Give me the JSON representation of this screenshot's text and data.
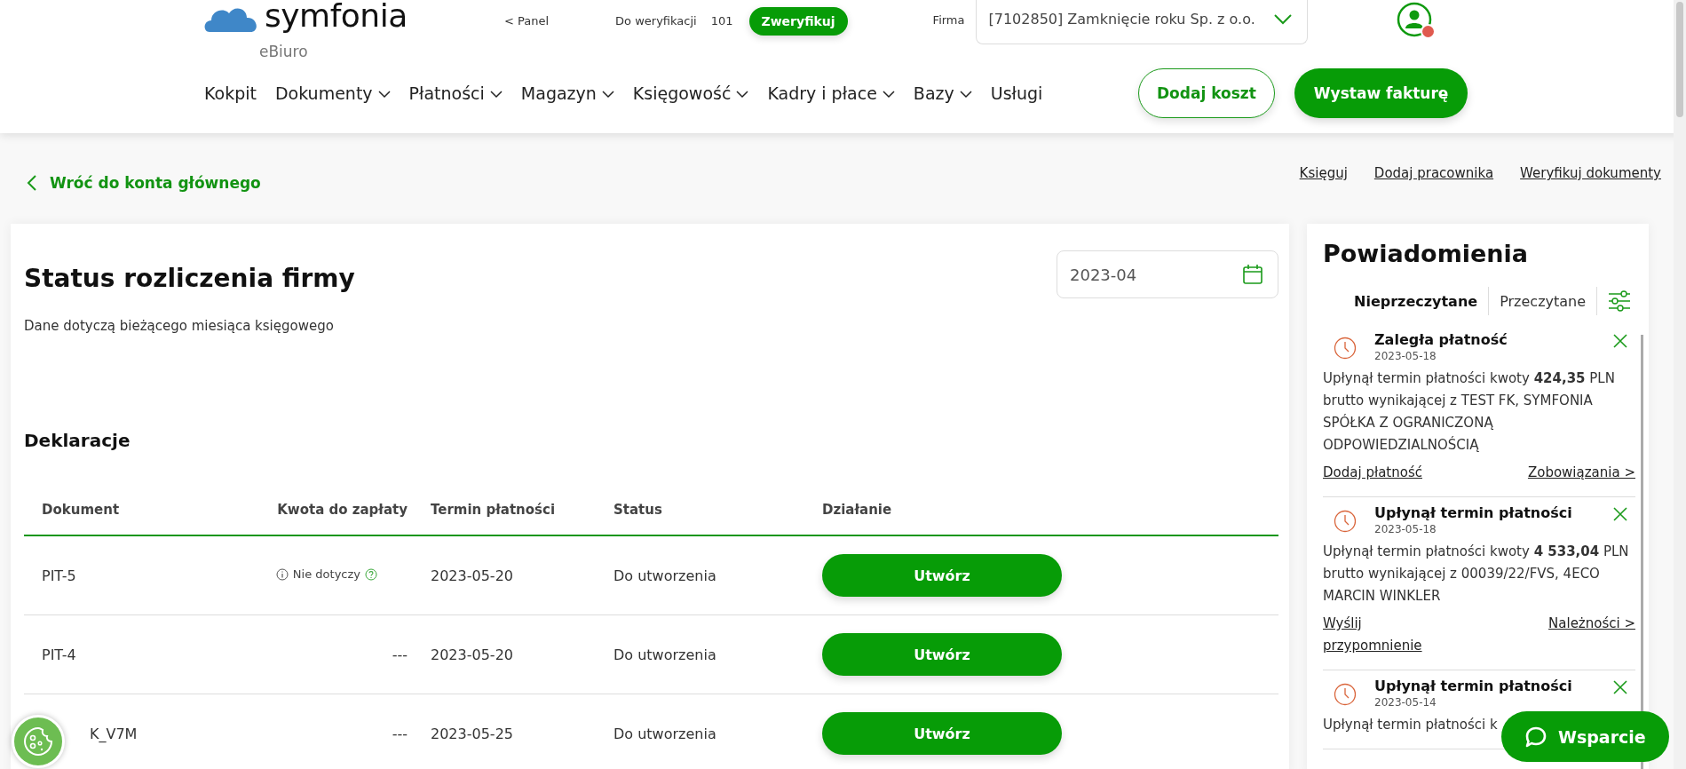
{
  "header": {
    "logo": {
      "name": "symfonia",
      "product": "eBiuro"
    },
    "panel_link": "< Panel",
    "verification": {
      "label": "Do weryfikacji",
      "count": "101",
      "button": "Zweryfikuj"
    },
    "company": {
      "label": "Firma",
      "value": "[7102850] Zamknięcie roku Sp. z o.o."
    },
    "user": {
      "notification_dot": true
    },
    "nav": [
      {
        "label": "Kokpit",
        "dropdown": false
      },
      {
        "label": "Dokumenty",
        "dropdown": true
      },
      {
        "label": "Płatności",
        "dropdown": true
      },
      {
        "label": "Magazyn",
        "dropdown": true
      },
      {
        "label": "Księgowość",
        "dropdown": true
      },
      {
        "label": "Kadry i płace",
        "dropdown": true
      },
      {
        "label": "Bazy",
        "dropdown": true
      },
      {
        "label": "Usługi",
        "dropdown": false
      }
    ],
    "actions": [
      {
        "label": "Dodaj koszt",
        "kind": "outline"
      },
      {
        "label": "Wystaw fakturę",
        "kind": "filled"
      }
    ]
  },
  "back_link": "Wróć do konta głównego",
  "quick_links": [
    "Księguj",
    "Dodaj pracownika",
    "Weryfikuj dokumenty"
  ],
  "status_card": {
    "title": "Status rozliczenia firmy",
    "subtitle": "Dane dotyczą bieżącego miesiąca księgowego",
    "period": "2023-04",
    "section": "Deklaracje",
    "columns": [
      "Dokument",
      "Kwota do zapłaty",
      "Termin płatności",
      "Status",
      "Działanie"
    ],
    "rows": [
      {
        "document": "PIT-5",
        "amount": {
          "kind": "info",
          "text": "Nie dotyczy"
        },
        "due": "2023-05-20",
        "status": "Do utworzenia",
        "action": "Utwórz"
      },
      {
        "document": "PIT-4",
        "amount": {
          "kind": "plain",
          "text": "---"
        },
        "due": "2023-05-20",
        "status": "Do utworzenia",
        "action": "Utwórz"
      },
      {
        "document": "K_V7M",
        "amount": {
          "kind": "plain",
          "text": "---"
        },
        "due": "2023-05-25",
        "status": "Do utworzenia",
        "action": "Utwórz"
      }
    ]
  },
  "notifications": {
    "title": "Powiadomienia",
    "tabs": [
      {
        "label": "Nieprzeczytane",
        "selected": true
      },
      {
        "label": "Przeczytane",
        "selected": false
      }
    ],
    "items": [
      {
        "title": "Zaległa płatność",
        "date": "2023-05-18",
        "body": "Upłynął termin płatności kwoty **424,35** PLN brutto wynikającej z TEST FK, SYMFONIA SPÓŁKA Z OGRANICZONĄ ODPOWIEDZIALNOŚCIĄ",
        "left_link": "Dodaj płatność",
        "right_link": "Zobowiązania >"
      },
      {
        "title": "Upłynął termin płatności",
        "date": "2023-05-18",
        "body": "Upłynął termin płatności kwoty **4 533,04** PLN brutto wynikającej z 00039/22/FVS, 4ECO MARCIN WINKLER",
        "left_link": "Wyślij przypomnienie",
        "right_link": "Należności >"
      },
      {
        "title": "Upłynął termin płatności",
        "date": "2023-05-14",
        "body": "Upłynął termin płatności k"
      }
    ]
  },
  "support_button": "Wsparcie"
}
